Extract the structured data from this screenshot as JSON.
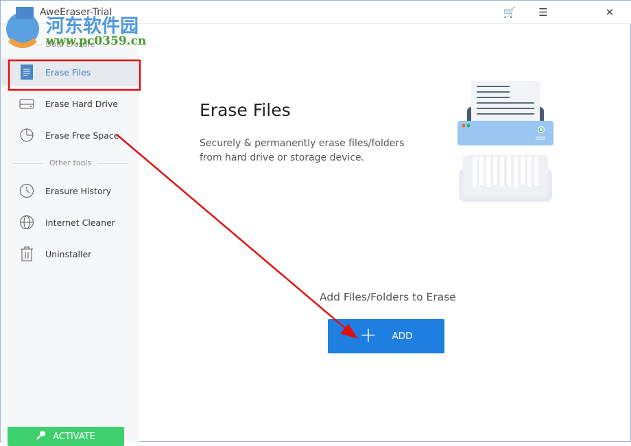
{
  "app": {
    "title": "AweEraser-Trial",
    "cart_icon": "cart-icon",
    "menu_icon": "menu-icon",
    "close_icon": "close-icon"
  },
  "sidebar": {
    "section_data": "Data Erasure",
    "section_other": "Other tools",
    "items": [
      {
        "label": "Erase Files",
        "icon": "file-icon",
        "active": true
      },
      {
        "label": "Erase Hard Drive",
        "icon": "hard-drive-icon"
      },
      {
        "label": "Erase Free Space",
        "icon": "pie-chart-icon"
      },
      {
        "label": "Erasure History",
        "icon": "clock-icon"
      },
      {
        "label": "Internet Cleaner",
        "icon": "globe-icon"
      },
      {
        "label": "Uninstaller",
        "icon": "trash-icon"
      }
    ],
    "activate_label": "ACTIVATE"
  },
  "main": {
    "title": "Erase Files",
    "description": "Securely & permanently erase files/folders from hard drive or storage device.",
    "add_prompt": "Add Files/Folders to Erase",
    "add_label": "ADD"
  },
  "watermark": {
    "line1": "河东软件园",
    "line2": "www.pc0359.cn"
  },
  "colors": {
    "accent": "#1f7fe0",
    "activate": "#3ecf6e",
    "annotation": "#e01010"
  }
}
